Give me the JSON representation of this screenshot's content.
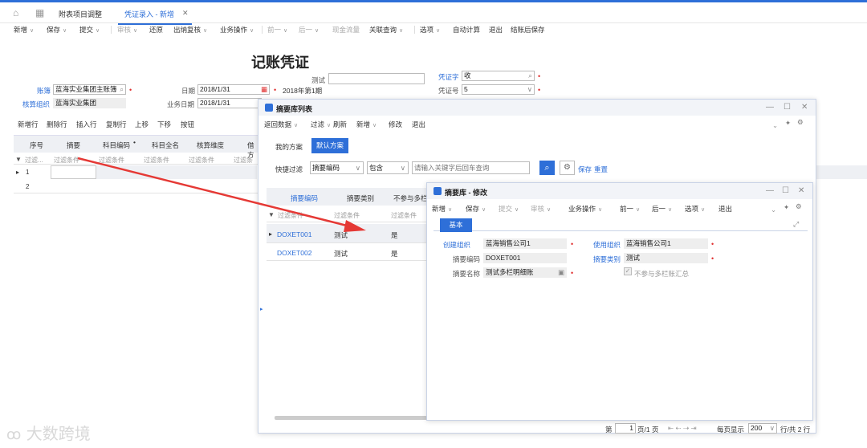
{
  "tabs": {
    "home_icon": "home-icon",
    "apps_icon": "apps-grid-icon",
    "tab1": "附表项目调整",
    "tab2": "凭证录入 - 新增",
    "tab2_close": "✕"
  },
  "toolbar": {
    "new": "新增",
    "save": "保存",
    "submit": "提交",
    "audit": "审核",
    "restore": "还原",
    "cashier_review": "出纳复核",
    "business_ops": "业务操作",
    "prev": "前一",
    "next": "后一",
    "cash_flow": "现金流量",
    "linked_query": "关联查询",
    "options": "选项",
    "auto_calc": "自动计算",
    "exit": "退出",
    "save_after_close": "结账后保存"
  },
  "voucher": {
    "title": "记账凭证",
    "test_label": "测试",
    "test_value": "",
    "voucher_word_label": "凭证字",
    "voucher_word_value": "收",
    "book_label": "账簿",
    "book_value": "蓝海实业集团主账簿",
    "date_label": "日期",
    "date_value": "2018/1/31",
    "period_text": "2018年第1期",
    "voucher_no_label": "凭证号",
    "voucher_no_value": "5",
    "acct_org_label": "核算组织",
    "acct_org_value": "蓝海实业集团",
    "biz_date_label": "业务日期",
    "biz_date_value": "2018/1/31"
  },
  "grid": {
    "toolbar": [
      "新增行",
      "删除行",
      "插入行",
      "复制行",
      "上移",
      "下移",
      "按钮"
    ],
    "headers": [
      "序号",
      "摘要",
      "科目编码",
      "科目全名",
      "核算维度",
      "借方"
    ],
    "filter": [
      "过滤...",
      "过滤条件",
      "过滤条件",
      "过滤条件",
      "过滤条件",
      "过滤条件"
    ],
    "rows": [
      "1",
      "2"
    ]
  },
  "summary_list": {
    "title": "摘要库列表",
    "toolbar": [
      "返回数据",
      "过滤",
      "刷新",
      "新增",
      "修改",
      "退出"
    ],
    "scheme_tabs": [
      "我的方案",
      "默认方案"
    ],
    "quick_filter_label": "快捷过滤",
    "field_select": "摘要编码",
    "op_select": "包含",
    "search_placeholder": "请输入关键字后回车查询",
    "save_link": "保存",
    "reset_link": "重置",
    "headers": [
      "摘要编码",
      "摘要类别",
      "不参与多栏"
    ],
    "filter": [
      "过滤条件",
      "过滤条件",
      "过滤条件"
    ],
    "rows": [
      {
        "code": "DOXET001",
        "category": "测试",
        "flag": "是"
      },
      {
        "code": "DOXET002",
        "category": "测试",
        "flag": "是"
      }
    ],
    "pager": {
      "page_label": "第",
      "page_value": "1",
      "page_total": "页/1 页",
      "per_page_label": "每页显示",
      "per_page_value": "200",
      "row_total": "行/共 2 行"
    }
  },
  "summary_edit": {
    "title": "摘要库 - 修改",
    "toolbar": [
      "新增",
      "保存",
      "提交",
      "审核",
      "业务操作",
      "前一",
      "后一",
      "选项",
      "退出"
    ],
    "tab_basic": "基本",
    "create_org_label": "创建组织",
    "create_org_value": "蓝海销售公司1",
    "use_org_label": "使用组织",
    "use_org_value": "蓝海销售公司1",
    "code_label": "摘要编码",
    "code_value": "DOXET001",
    "category_label": "摘要类别",
    "category_value": "测试",
    "name_label": "摘要名称",
    "name_value": "测试多栏明细账",
    "no_multi_label": "不参与多栏账汇总"
  },
  "watermark": "大数跨境",
  "colors": {
    "accent": "#2e6fd8",
    "required": "#e03030",
    "arrow": "#e53935"
  }
}
